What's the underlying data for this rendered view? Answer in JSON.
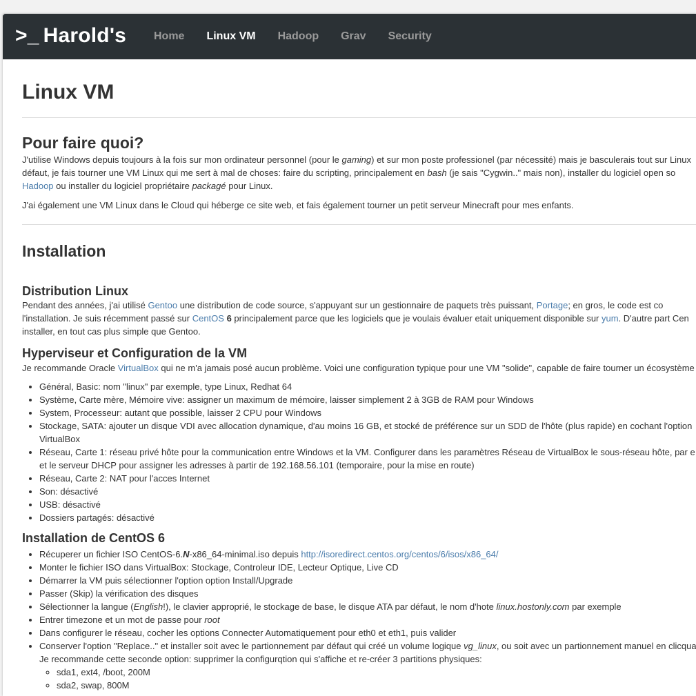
{
  "brand": {
    "prompt": ">_",
    "name": "Harold's"
  },
  "nav": [
    "Home",
    "Linux VM",
    "Hadoop",
    "Grav",
    "Security"
  ],
  "page_title": "Linux VM",
  "s1": {
    "title": "Pour faire quoi?",
    "p1_l1a": "J'utilise Windows depuis toujours à la fois sur mon ordinateur personnel (pour le ",
    "p1_l1_em": "gaming",
    "p1_l1b": ") et sur mon poste professionel (par nécessité) mais je basculerais tout sur Linux",
    "p1_l2a": "défaut, je fais tourner une VM Linux qui me sert à mal de choses: faire du scripting, principalement en ",
    "p1_l2_em": "bash",
    "p1_l2b": " (je sais \"Cygwin..\" mais non), installer du logiciel open so",
    "p1_l3_link": "Hadoop",
    "p1_l3a": " ou installer du logiciel propriétaire ",
    "p1_l3_em": "packagé",
    "p1_l3b": " pour Linux.",
    "p2": "J'ai également une VM Linux dans le Cloud qui héberge ce site web, et fais également tourner un petit serveur Minecraft pour mes enfants."
  },
  "s2": {
    "title": "Installation"
  },
  "dist": {
    "title": "Distribution Linux",
    "l1a": "Pendant des années, j'ai utilisé ",
    "l1_link1": "Gentoo",
    "l1b": " une distribution de code source, s'appuyant sur un gestionnaire de paquets très puissant, ",
    "l1_link2": "Portage",
    "l1c": "; en gros, le code est co",
    "l2a": "l'installation. Je suis récemment passé sur ",
    "l2_link1": "CentOS",
    "l2_bold": " 6",
    "l2b": " principalement parce que les logiciels que je voulais évaluer etait uniquement disponible sur ",
    "l2_link2": "yum",
    "l2c": ". D'autre part Cen",
    "l3": "installer, en tout cas plus simple que Gentoo."
  },
  "hyper": {
    "title": "Hyperviseur et Configuration de la VM",
    "intro_a": "Je recommande Oracle ",
    "intro_link": "VirtualBox",
    "intro_b": " qui ne m'a jamais posé aucun problème. Voici une configuration typique pour une VM \"solide\", capable de faire tourner un écosystème",
    "items": [
      "Général, Basic: nom \"linux\" par exemple, type Linux, Redhat 64",
      "Système, Carte mère, Mémoire vive: assigner un maximum de mémoire, laisser simplement 2 à 3GB de RAM pour Windows",
      "System, Processeur: autant que possible, laisser 2 CPU pour Windows",
      "Réseau, Carte 2: NAT pour l'acces Internet",
      "Son: désactivé",
      "USB: désactivé",
      "Dossiers partagés: désactivé"
    ],
    "storage_l1": "Stockage, SATA: ajouter un disque VDI avec allocation dynamique, d'au moins 16 GB, et stocké de préférence sur un SDD de l'hôte (plus rapide) en cochant l'option",
    "storage_l2": "VirtualBox",
    "net1_l1": "Réseau, Carte 1: réseau privé hôte pour la communication entre Windows et la VM. Configurer dans les paramètres Réseau de VirtualBox le sous-réseau hôte, par e",
    "net1_l2": "et le serveur DHCP pour assigner les adresses à partir de 192.168.56.101 (temporaire, pour la mise en route)"
  },
  "centos": {
    "title": "Installation de CentOS 6",
    "iso_a": "Récuperer un fichier ISO CentOS-6.",
    "iso_b": "N",
    "iso_c": "-x86_64-minimal.iso depuis ",
    "iso_link": "http://isoredirect.centos.org/centos/6/isos/x86_64/",
    "mount": "Monter le fichier ISO dans VirtualBox: Stockage, Controleur IDE, Lecteur Optique, Live CD",
    "boot": "Démarrer la VM puis sélectionner l'option option Install/Upgrade",
    "skip": "Passer (Skip) la vérification des disques",
    "lang_a": "Sélectionner la langue (",
    "lang_em": "English",
    "lang_b": "!), le clavier approprié, le stockage de base, le disque ATA par défaut, le nom d'hote ",
    "lang_em2": "linux.hostonly.com",
    "lang_c": " par exemple",
    "tz_a": "Entrer timezone et un mot de passe pour ",
    "tz_em": "root",
    "net": "Dans configurer le réseau, cocher les options Connecter Automatiquement pour eth0 et eth1, puis valider",
    "part_a": "Conserver l'option \"Replace..\" et installer soit avec le partionnement par défaut qui créé un volume logique ",
    "part_em": "vg_linux",
    "part_b": ", ou soit avec un partionnement manuel en clicqua",
    "part_l2": "Je recommande cette seconde option: supprimer la configurqtion qui s'affiche et re-créer 3 partitions physiques:",
    "sub": [
      "sda1, ext4, /boot, 200M",
      "sda2, swap, 800M"
    ]
  }
}
